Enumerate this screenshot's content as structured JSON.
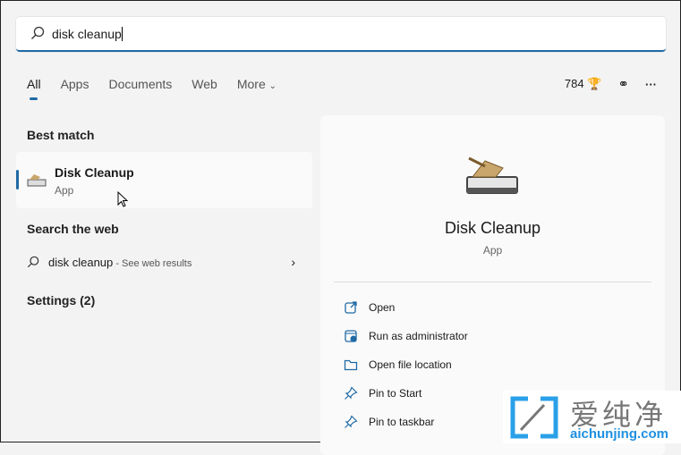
{
  "search": {
    "value": "disk cleanup"
  },
  "tabs": [
    {
      "label": "All"
    },
    {
      "label": "Apps"
    },
    {
      "label": "Documents"
    },
    {
      "label": "Web"
    },
    {
      "label": "More"
    }
  ],
  "toolbar": {
    "points": "784"
  },
  "best_match": {
    "heading": "Best match",
    "title": "Disk Cleanup",
    "subtitle": "App"
  },
  "web": {
    "heading": "Search the web",
    "query": "disk cleanup",
    "suffix": " - See web results"
  },
  "settings": {
    "heading": "Settings (2)"
  },
  "details": {
    "name": "Disk Cleanup",
    "type": "App",
    "actions": [
      {
        "label": "Open"
      },
      {
        "label": "Run as administrator"
      },
      {
        "label": "Open file location"
      },
      {
        "label": "Pin to Start"
      },
      {
        "label": "Pin to taskbar"
      }
    ]
  },
  "watermark": {
    "text": "爱纯净",
    "url": "aichunjing.com"
  },
  "colors": {
    "accent": "#1f6aa5"
  }
}
